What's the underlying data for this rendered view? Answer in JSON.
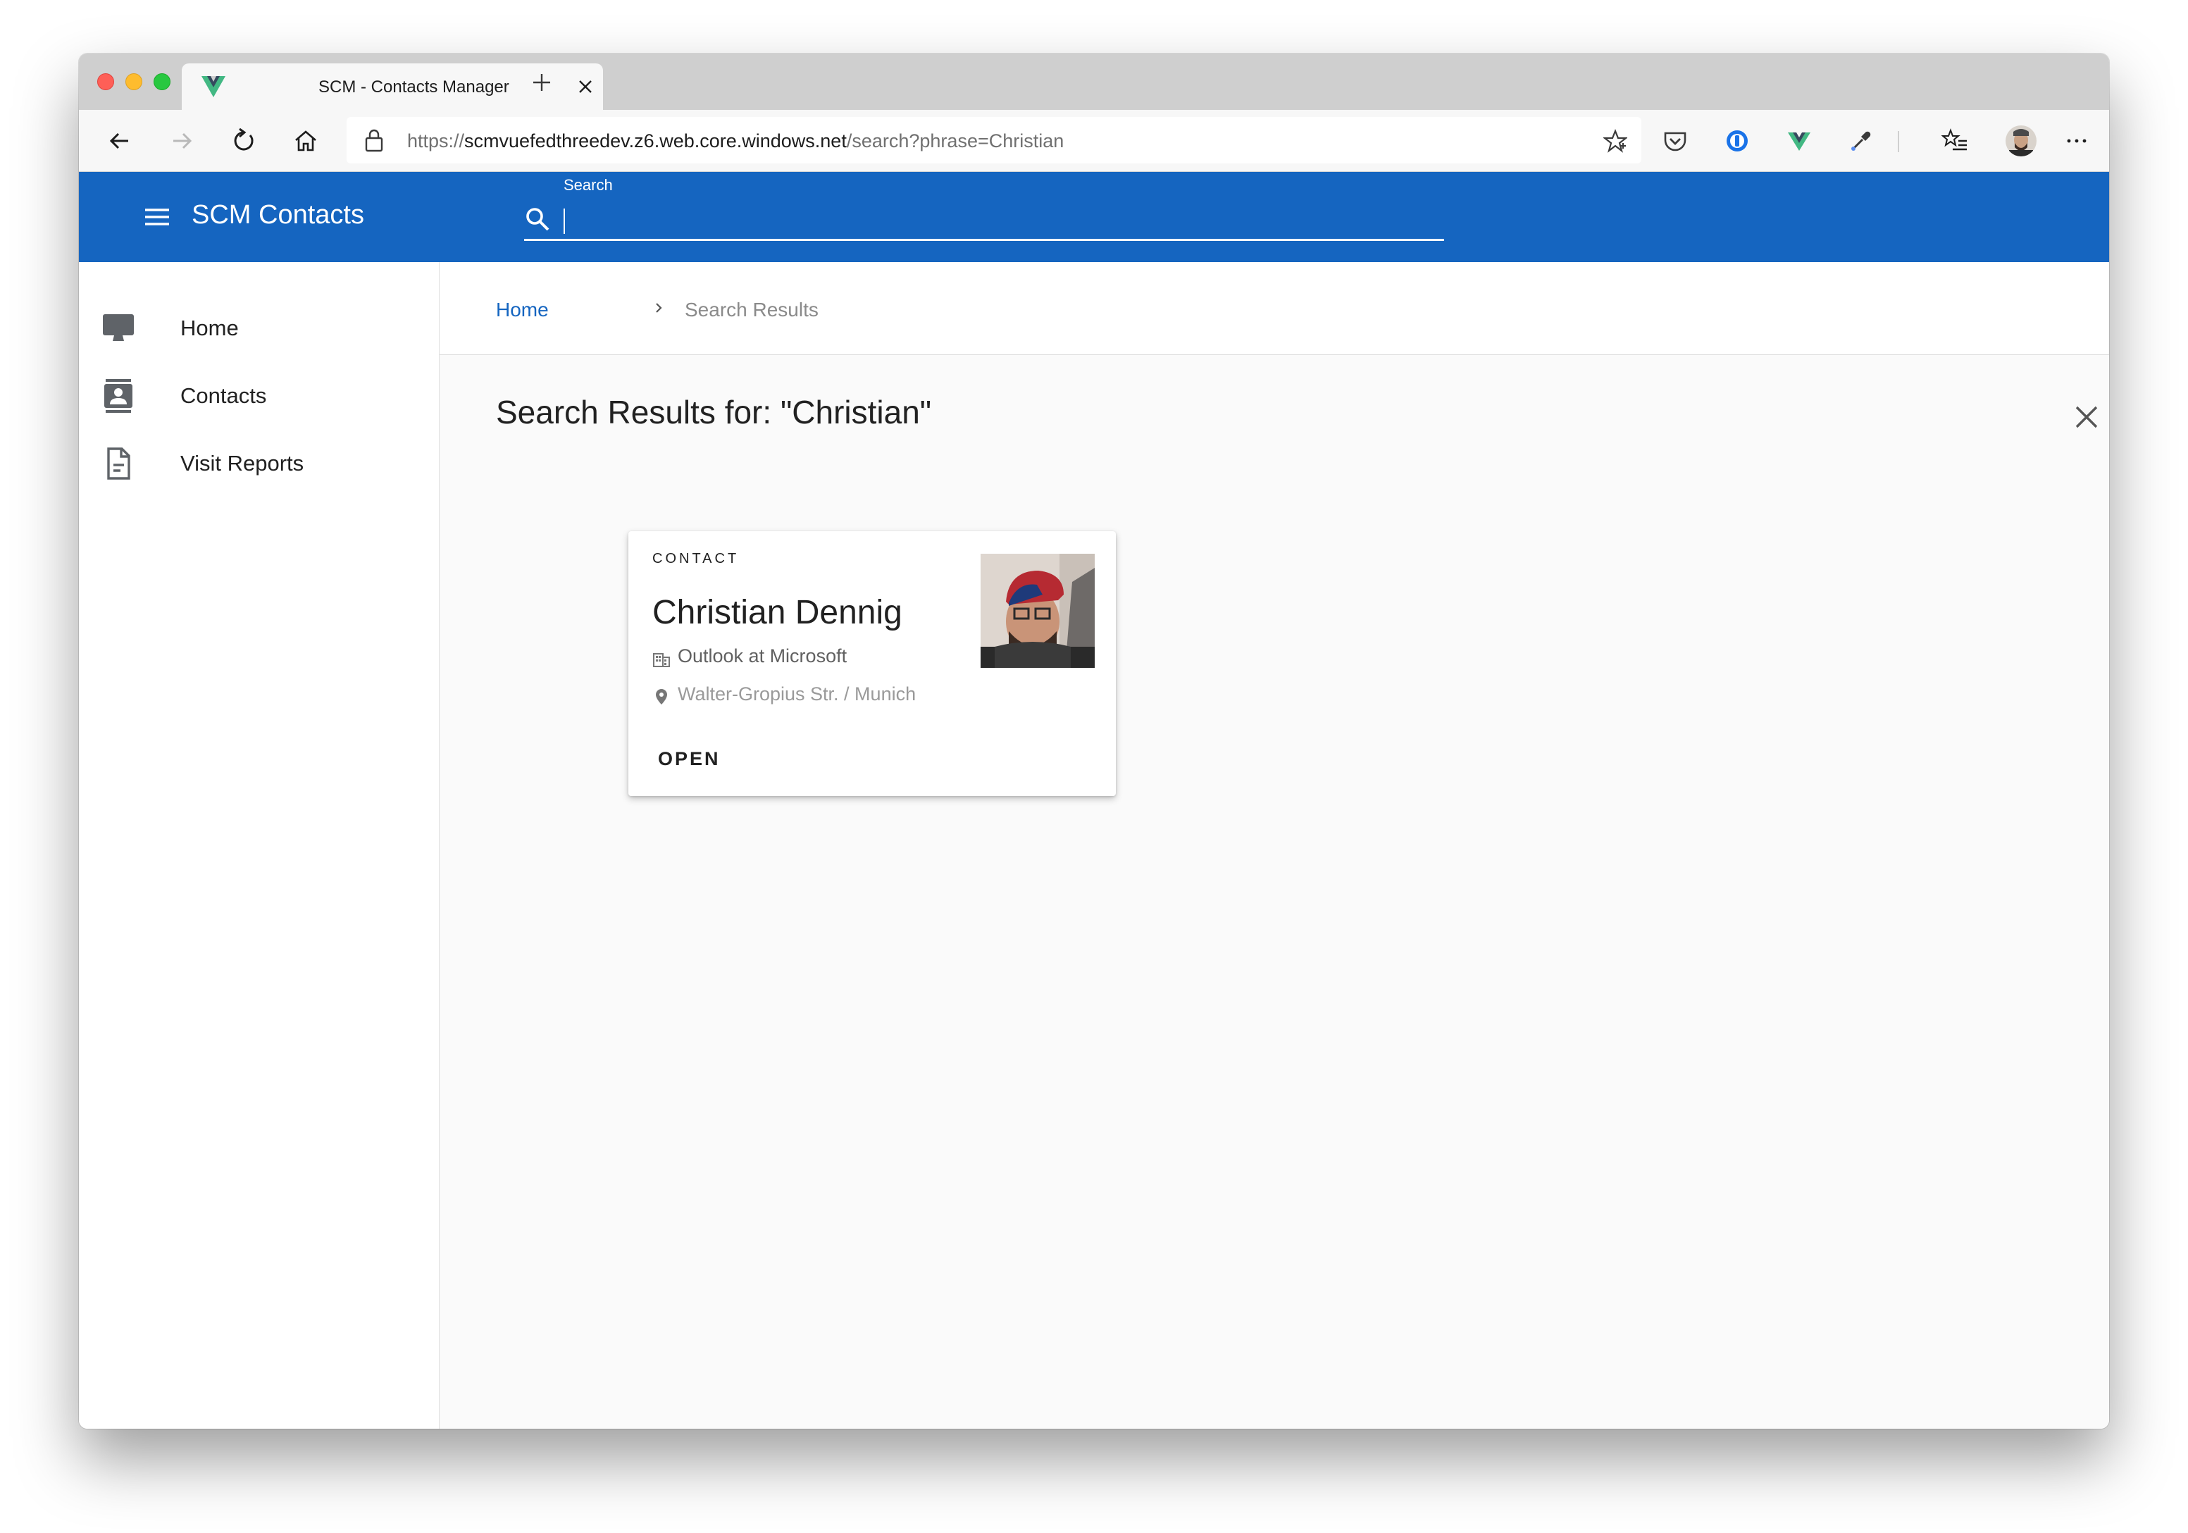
{
  "browser": {
    "tab_title": "SCM - Contacts Manager",
    "url_prefix": "https://",
    "url_host": "scmvuefedthreedev.z6.web.core.windows.net",
    "url_path": "/search?phrase=Christian"
  },
  "appbar": {
    "title": "SCM Contacts",
    "search_label": "Search",
    "search_value": ""
  },
  "sidebar": {
    "items": [
      {
        "label": "Home",
        "icon": "monitor-icon"
      },
      {
        "label": "Contacts",
        "icon": "contacts-icon"
      },
      {
        "label": "Visit Reports",
        "icon": "document-icon"
      }
    ]
  },
  "breadcrumb": {
    "home": "Home",
    "current": "Search Results"
  },
  "results": {
    "heading": "Search Results for: \"Christian\""
  },
  "card": {
    "overline": "CONTACT",
    "name": "Christian Dennig",
    "company": "Outlook at Microsoft",
    "address": "Walter-Gropius Str. / Munich",
    "action": "OPEN"
  },
  "colors": {
    "primary": "#1565c0",
    "accent_vue_green": "#42b883",
    "background": "#fafafa"
  }
}
